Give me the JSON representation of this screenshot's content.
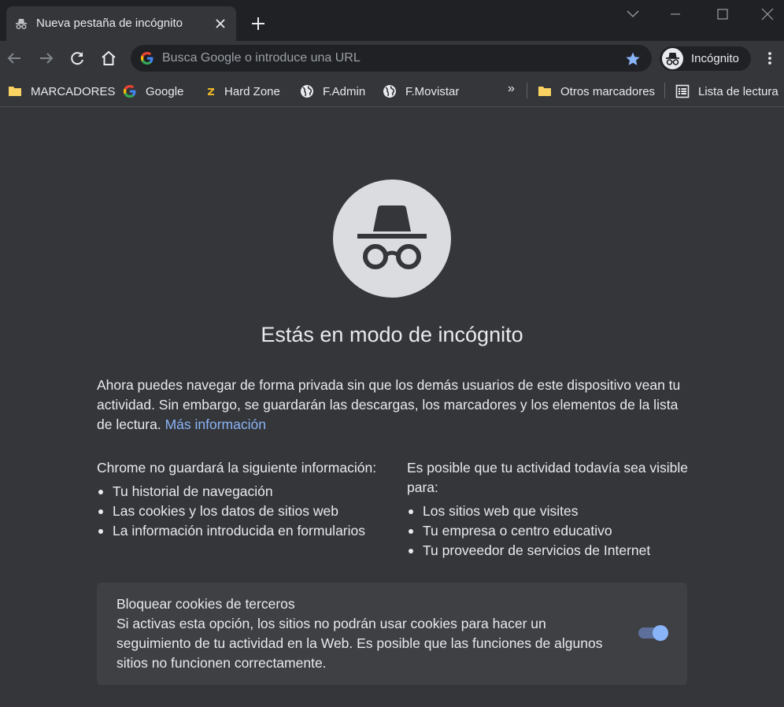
{
  "tab": {
    "title": "Nueva pestaña de incógnito"
  },
  "omnibox": {
    "placeholder": "Busca Google o introduce una URL"
  },
  "profile": {
    "label": "Incógnito"
  },
  "bookmarks": {
    "items": [
      {
        "label": "MARCADORES",
        "icon": "folder-icon"
      },
      {
        "label": "Google",
        "icon": "google-icon"
      },
      {
        "label": "Hard Zone",
        "icon": "hardzone-icon"
      },
      {
        "label": "F.Admin",
        "icon": "globe-icon"
      },
      {
        "label": "F.Movistar",
        "icon": "globe-icon"
      }
    ],
    "overflow": "»",
    "other": "Otros marcadores",
    "reading_list": "Lista de lectura"
  },
  "main": {
    "heading": "Estás en modo de incógnito",
    "intro": "Ahora puedes navegar de forma privada sin que los demás usuarios de este dispositivo vean tu actividad. Sin embargo, se guardarán las descargas, los marcadores y los elementos de la lista de lectura.",
    "learn_more": "Más información",
    "not_saved": {
      "title": "Chrome no guardará la siguiente información:",
      "items": [
        "Tu historial de navegación",
        "Las cookies y los datos de sitios web",
        "La información introducida en formularios"
      ]
    },
    "visible_to": {
      "title": "Es posible que tu actividad todavía sea visible para:",
      "items": [
        "Los sitios web que visites",
        "Tu empresa o centro educativo",
        "Tu proveedor de servicios de Internet"
      ]
    },
    "cookies": {
      "title": "Bloquear cookies de terceros",
      "description": "Si activas esta opción, los sitios no podrán usar cookies para hacer un seguimiento de tu actividad en la Web. Es posible que las funciones de algunos sitios no funcionen correctamente.",
      "enabled": true
    }
  },
  "colors": {
    "frame": "#202124",
    "toolbar": "#35363a",
    "page_bg": "#35363a",
    "card_bg": "#3f4044",
    "text": "#e8eaed",
    "link": "#8ab4f8",
    "accent_star": "#8ab4f8"
  }
}
